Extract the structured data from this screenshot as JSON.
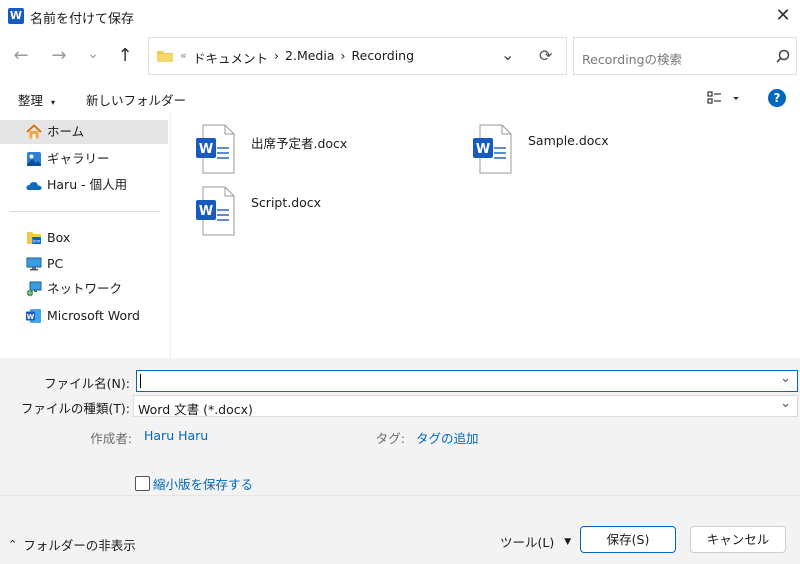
{
  "window": {
    "title": "名前を付けて保存",
    "close_glyph": "✕"
  },
  "nav": {
    "back_glyph": "←",
    "forward_glyph": "→",
    "recent_glyph": "⌄",
    "up_glyph": "↑",
    "refresh_glyph": "⟳",
    "dropdown_glyph": "⌄",
    "path_more": "«",
    "breadcrumb": [
      "ドキュメント",
      "2.Media",
      "Recording"
    ],
    "separator": "›",
    "search_placeholder": "Recordingの検索"
  },
  "toolbar": {
    "organize": "整理",
    "new_folder": "新しいフォルダー",
    "help": "?"
  },
  "sidebar": {
    "items": [
      {
        "label": "ホーム",
        "icon": "home-icon"
      },
      {
        "label": "ギャラリー",
        "icon": "gallery-icon"
      },
      {
        "label": "Haru - 個人用",
        "icon": "onedrive-icon"
      },
      {
        "label": "Box",
        "icon": "box-icon"
      },
      {
        "label": "PC",
        "icon": "pc-icon"
      },
      {
        "label": "ネットワーク",
        "icon": "network-icon"
      },
      {
        "label": "Microsoft Word",
        "icon": "word-icon"
      }
    ]
  },
  "files": [
    {
      "name": "出席予定者.docx"
    },
    {
      "name": "Sample.docx"
    },
    {
      "name": "Script.docx"
    }
  ],
  "form": {
    "filename_label": "ファイル名(N):",
    "filename_value": "",
    "filetype_label": "ファイルの種類(T):",
    "filetype_value": "Word 文書 (*.docx)",
    "author_label": "作成者:",
    "author_value": "Haru Haru",
    "tags_label": "タグ:",
    "tags_value": "タグの追加",
    "thumbnail_label": "縮小版を保存する",
    "thumbnail_checked": false
  },
  "footer": {
    "hide_folders": "フォルダーの非表示",
    "tools": "ツール(L)",
    "save": "保存(S)",
    "cancel": "キャンセル"
  },
  "colors": {
    "accent": "#0067c0",
    "word_blue": "#185abd",
    "folder_yellow": "#f2c94c",
    "selection": "#e5e5e5"
  }
}
